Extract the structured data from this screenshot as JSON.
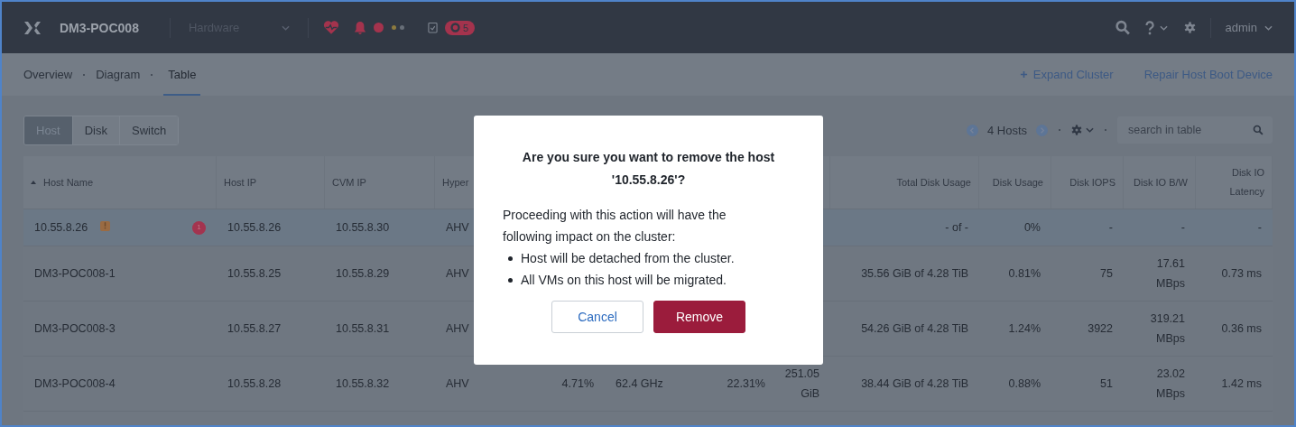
{
  "topbar": {
    "cluster_name": "DM3-POC008",
    "view_selector": {
      "value": "Hardware"
    },
    "task_count": "5",
    "user": "admin"
  },
  "nav_tabs": [
    {
      "label": "Overview",
      "selected": false
    },
    {
      "label": "Diagram",
      "selected": false
    },
    {
      "label": "Table",
      "selected": true
    }
  ],
  "actions": [
    {
      "label": "Expand Cluster",
      "kind": "add"
    },
    {
      "label": "Repair Host Boot Device",
      "kind": "plain"
    }
  ],
  "entity_tabs": [
    {
      "label": "Host",
      "selected": true
    },
    {
      "label": "Disk",
      "selected": false
    },
    {
      "label": "Switch",
      "selected": false
    }
  ],
  "pager": {
    "label": "4 Hosts"
  },
  "search": {
    "placeholder": "search in table"
  },
  "table": {
    "columns": [
      {
        "label": "Host Name",
        "sorted": true
      },
      {
        "label": "Host IP",
        "sorted": false
      },
      {
        "label": "CVM IP",
        "sorted": false
      },
      {
        "label": "Hyper",
        "sorted": false
      },
      {},
      {},
      {},
      {},
      {
        "label": "Total Disk Usage",
        "sorted": false
      },
      {
        "label": "Disk Usage",
        "sorted": false
      },
      {
        "label": "Disk IOPS",
        "sorted": false
      },
      {
        "label": "Disk IO B/W",
        "sorted": false
      },
      {
        "label": "Disk IO Latency",
        "sorted": false
      }
    ],
    "rows": [
      {
        "selected": true,
        "warning": true,
        "alert_count": "1",
        "cells": [
          "10.55.8.26",
          "10.55.8.26",
          "10.55.8.30",
          "AHV",
          null,
          null,
          null,
          null,
          "- of -",
          "0%",
          "-",
          "-",
          "-"
        ]
      },
      {
        "selected": false,
        "warning": false,
        "cells": [
          "DM3-POC008-1",
          "10.55.8.25",
          "10.55.8.29",
          "AHV",
          null,
          null,
          null,
          null,
          "35.56 GiB of 4.28 TiB",
          "0.81%",
          "75",
          "17.61 MBps",
          "0.73 ms"
        ]
      },
      {
        "selected": false,
        "warning": false,
        "cells": [
          "DM3-POC008-3",
          "10.55.8.27",
          "10.55.8.31",
          "AHV",
          null,
          null,
          null,
          null,
          "54.26 GiB of 4.28 TiB",
          "1.24%",
          "3922",
          "319.21 MBps",
          "0.36 ms"
        ]
      },
      {
        "selected": false,
        "warning": false,
        "cells": [
          "DM3-POC008-4",
          "10.55.8.28",
          "10.55.8.32",
          "AHV",
          "4.71%",
          "62.4 GHz",
          "22.31%",
          "251.05 GiB",
          "38.44 GiB of 4.28 TiB",
          "0.88%",
          "51",
          "23.02 MBps",
          "1.42 ms"
        ]
      }
    ]
  },
  "dialog": {
    "title": "Are you sure you want to remove the host '10.55.8.26'?",
    "message": "Proceeding with this action will have the following impact on the cluster:",
    "bullets": [
      "Host will be detached from the cluster.",
      "All VMs on this host will be migrated."
    ],
    "buttons": [
      {
        "label": "Cancel",
        "kind": "secondary"
      },
      {
        "label": "Remove",
        "kind": "danger"
      }
    ]
  }
}
